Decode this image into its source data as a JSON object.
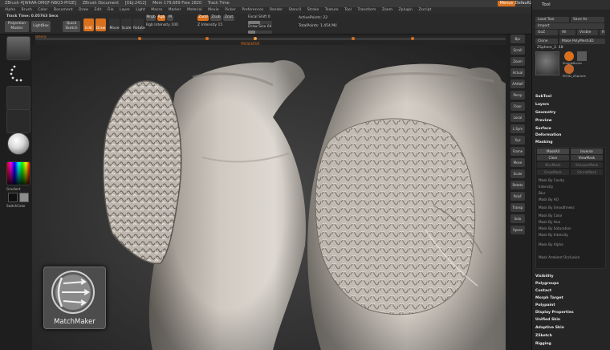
{
  "titlebar": {
    "items": [
      "ZBrush 4[WKAR-DMQF-NBQ3-PH2E]",
      "ZBrush Document",
      "[Obj:2412]",
      "Mem 179,689 Free 2820",
      "Track Time"
    ],
    "badge": "Menus",
    "script": "DefaultZScript",
    "window_buttons": "? ◻ ×"
  },
  "menubar": {
    "items": [
      "Alpha",
      "Brush",
      "Color",
      "Document",
      "Draw",
      "Edit",
      "File",
      "Layer",
      "Light",
      "Macro",
      "Marker",
      "Material",
      "Movie",
      "Picker",
      "Preferences",
      "Render",
      "Stencil",
      "Stroke",
      "Texture",
      "Tool",
      "Transform",
      "Zoom",
      "Zplugin",
      "Zscript"
    ]
  },
  "shelf": {
    "track_time": "Track Time: 0.05763 Secs",
    "projection_master": "Projection Master",
    "lightbox": "LightBox",
    "quick_sketch": "Quick Sketch",
    "edit": "Edit",
    "draw": "Draw",
    "move": "Move",
    "scale": "Scale",
    "rotate": "Rotate",
    "mrgb": "Mrgb",
    "rgb": "Rgb",
    "m": "M",
    "zadd": "Zadd",
    "zsub": "Zsub",
    "zcut": "Zcut",
    "focal_shift": "Focal Shift 0",
    "draw_size": "Draw Size 64",
    "rgb_intensity": "Rgb Intensity 100",
    "z_intensity": "Z Intensity 15",
    "active_points": "ActivePoints: 22",
    "total_points": "TotalPoints: 1.454 Mil"
  },
  "timeline": {
    "camera": "Camera",
    "marker": "PRESENTER"
  },
  "left_tray": {
    "gradient": "Gradient",
    "switch_color": "SwitchColor"
  },
  "right_icons": [
    "Bpr",
    "Scroll",
    "Zoom",
    "Actual",
    "AAHalf",
    "Persp",
    "Floor",
    "Local",
    "L.Sym",
    "Xyz",
    "Frame",
    "Move",
    "Scale",
    "Rotate",
    "PolyF",
    "Transp",
    "Solo",
    "Xpose"
  ],
  "tool_palette": {
    "title": "Tool",
    "load_tool": "Load Tool",
    "save_as": "Save As",
    "import": "Import",
    "export": "Export",
    "goz": "GoZ",
    "all": "All",
    "visible": "Visible",
    "r": "R",
    "clone": "Clone",
    "make_polymesh": "Make PolyMesh3D",
    "tool_name": "ZSphere_2. 48",
    "meshes": [
      "Polymesh3D",
      "SimpleBrush",
      "ZSphere_2",
      "PM3D_ZSphere"
    ],
    "sections": [
      "SubTool",
      "Layers",
      "Geometry",
      "Preview",
      "Surface",
      "Deformation",
      "Masking"
    ],
    "masking_buttons": [
      "MaskAll",
      "Inverse",
      "Clear",
      "ViewMask",
      "BlurMask",
      "SharpenMask",
      "GrowMask",
      "ShrinkMask",
      "Mask By Cavity",
      "Intensity",
      "Blur",
      "Mask By AO",
      "Mask By Smoothness",
      "Mask By Color",
      "Mask By Hue",
      "Mask By Saturation",
      "Mask By Intensity",
      "Mask By Alpha",
      "Mask Ambient Occlusion"
    ],
    "bottom_sections": [
      "Visibility",
      "Polygroups",
      "Contact",
      "Morph Target",
      "Polypaint",
      "Display Properties",
      "Unified Skin",
      "Adaptive Skin",
      "ZSketch",
      "Rigging"
    ]
  },
  "matchmaker": {
    "label": "MatchMaker"
  },
  "colors": {
    "accent": "#d8701e",
    "panel": "#252525",
    "clay": "#c9c3bb"
  }
}
